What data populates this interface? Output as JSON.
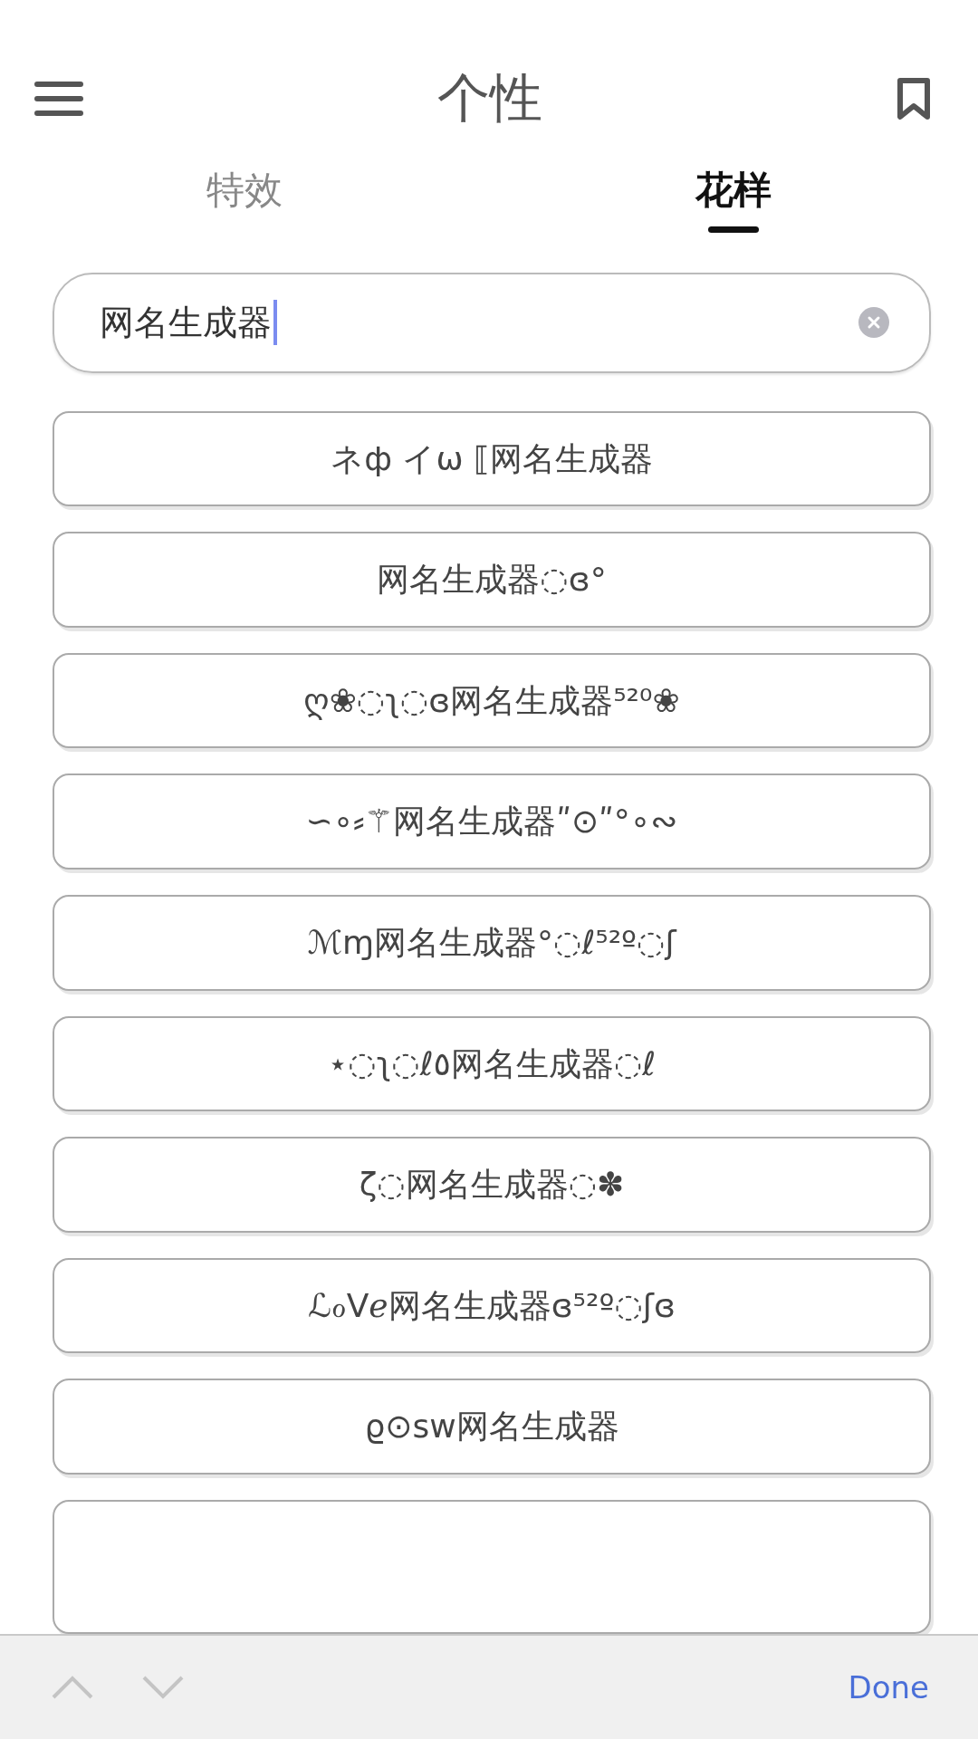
{
  "header": {
    "title": "个性"
  },
  "tabs": [
    {
      "label": "特效",
      "selected": false
    },
    {
      "label": "花样",
      "selected": true
    }
  ],
  "search": {
    "value": "网名生成器"
  },
  "results": [
    "ネф イω ⟦网名生成器",
    "网名生成器◌ɞ°",
    "ღ❀◌ʅ◌ɞ网名生成器⁵²⁰❀",
    "∽∘⸗⚚网名生成器ʺ⊙ʺ°∘∾",
    "ℳɱ网名生成器°◌ℓ⁵²º◌ʃ",
    "⋆◌ʅ◌ℓ٥网名生成器◌ℓ",
    "ζ◌网名生成器◌✽",
    "ℒℴVℯ网名生成器ɞ⁵²º◌ʃɞ",
    "ϱ⊙sw网名生成器"
  ],
  "keyboard_bar": {
    "done": "Done"
  }
}
